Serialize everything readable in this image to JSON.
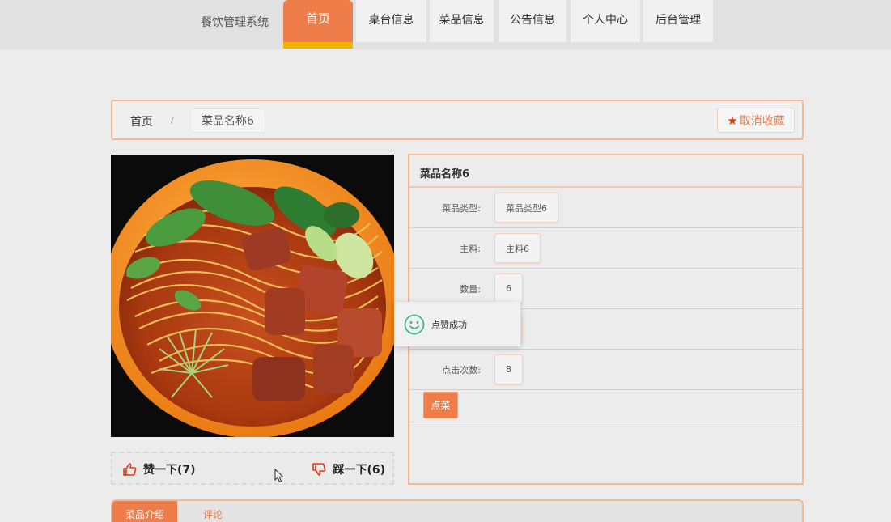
{
  "nav": {
    "brand": "餐饮管理系统",
    "items": [
      {
        "label": "首页",
        "active": true
      },
      {
        "label": "桌台信息"
      },
      {
        "label": "菜品信息"
      },
      {
        "label": "公告信息"
      },
      {
        "label": "个人中心"
      },
      {
        "label": "后台管理"
      }
    ]
  },
  "breadcrumb": {
    "home": "首页",
    "separator": "/",
    "current": "菜品名称6"
  },
  "favorite": {
    "label": "取消收藏",
    "icon": "star-icon"
  },
  "food": {
    "image_alt_icon": "noodle-dish-photo"
  },
  "likes": {
    "like_label": "赞一下(7)",
    "dislike_label": "踩一下(6)"
  },
  "detail": {
    "title": "菜品名称6",
    "rows": [
      {
        "label": "菜品类型:",
        "value": "菜品类型6"
      },
      {
        "label": "主料:",
        "value": "主料6"
      },
      {
        "label": "数量:",
        "value": "6"
      },
      {
        "label": "",
        "value": ""
      },
      {
        "label": "点击次数:",
        "value": "8"
      }
    ],
    "order_button": "点菜"
  },
  "toast": {
    "message": "点赞成功",
    "icon": "smile-icon"
  },
  "tabs": [
    {
      "label": "菜品介绍",
      "active": true
    },
    {
      "label": "评论"
    }
  ],
  "colors": {
    "accent": "#ef7d4a",
    "accent_bar": "#f0b400",
    "border": "#f6b896",
    "star": "#e8380d",
    "toast_icon": "#3dbb8f"
  }
}
